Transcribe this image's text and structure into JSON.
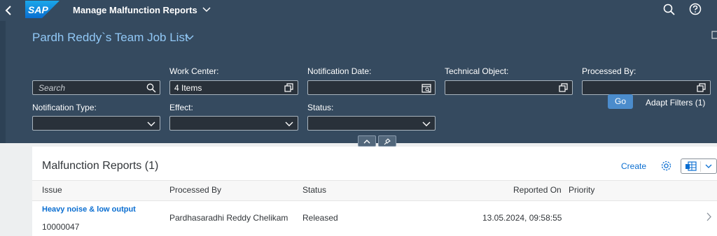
{
  "shell": {
    "app_title": "Manage Malfunction Reports",
    "logo_text": "SAP"
  },
  "header": {
    "variant_title": "Pardh Reddy`s Team Job List"
  },
  "filters": {
    "search_placeholder": "Search",
    "work_center": {
      "label": "Work Center:",
      "value": "4 Items"
    },
    "notification_date": {
      "label": "Notification Date:",
      "value": ""
    },
    "technical_object": {
      "label": "Technical Object:",
      "value": ""
    },
    "processed_by": {
      "label": "Processed By:",
      "value": ""
    },
    "notification_type": {
      "label": "Notification Type:",
      "value": ""
    },
    "effect": {
      "label": "Effect:",
      "value": ""
    },
    "status": {
      "label": "Status:",
      "value": ""
    },
    "go_label": "Go",
    "adapt_label": "Adapt Filters (1)"
  },
  "table": {
    "title": "Malfunction Reports (1)",
    "create_label": "Create",
    "columns": [
      "Issue",
      "Processed By",
      "Status",
      "Reported On",
      "Priority"
    ],
    "rows": [
      {
        "issue_title": "Heavy noise & low output",
        "issue_id": "10000047",
        "processed_by": "Pardhasaradhi Reddy Chelikam",
        "status": "Released",
        "reported_on": "13.05.2024, 09:58:55",
        "priority": ""
      }
    ]
  },
  "icons": {
    "back": "back-arrow-icon",
    "search": "search-icon",
    "help": "help-icon",
    "value_help": "value-help-icon",
    "calendar": "calendar-icon",
    "dropdown": "chevron-down-icon",
    "collapse": "chevron-up-icon",
    "pin": "pin-icon",
    "settings": "gear-icon",
    "export": "export-spreadsheet-icon",
    "navigation": "chevron-right-icon"
  },
  "colors": {
    "shell_bg": "#354a5f",
    "header_bg": "#354a5f",
    "link": "#0a6ed1",
    "variant_title": "#91c8f6",
    "go_button": "#4b8ccc",
    "field_bg": "#29313a"
  }
}
